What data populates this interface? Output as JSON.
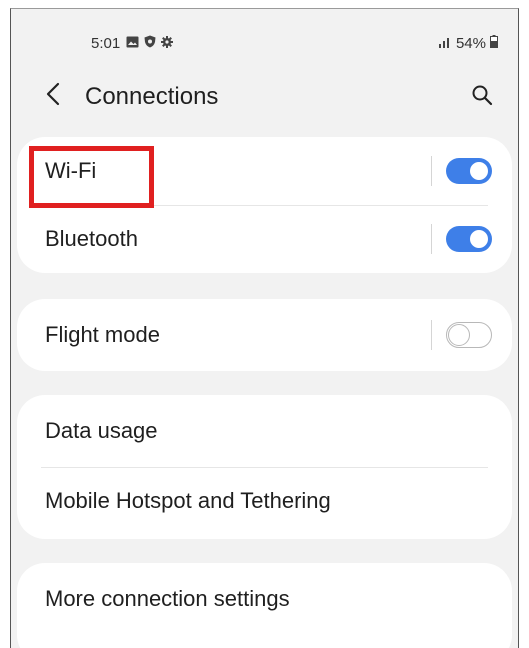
{
  "status_bar": {
    "time": "5:01",
    "icons": [
      "gallery-icon",
      "shield-icon",
      "settings-gear-icon"
    ],
    "signal_icon": "signal-icon",
    "battery_text": "54%",
    "battery_icon": "battery-icon"
  },
  "header": {
    "back_icon": "chevron-left-icon",
    "title": "Connections",
    "search_icon": "search-icon"
  },
  "groups": [
    {
      "items": [
        {
          "label": "Wi-Fi",
          "toggle": true,
          "state": "on"
        },
        {
          "label": "Bluetooth",
          "toggle": true,
          "state": "on"
        }
      ]
    },
    {
      "items": [
        {
          "label": "Flight mode",
          "toggle": true,
          "state": "off"
        }
      ]
    },
    {
      "items": [
        {
          "label": "Data usage",
          "toggle": false
        },
        {
          "label": "Mobile Hotspot and Tethering",
          "toggle": false
        }
      ]
    },
    {
      "items": [
        {
          "label": "More connection settings",
          "toggle": false
        }
      ]
    }
  ],
  "annotation": {
    "highlight_color": "#e02020",
    "highlighted_item": "Wi-Fi"
  },
  "colors": {
    "accent": "#3e7fe8",
    "background": "#f2f2f2",
    "card": "#ffffff",
    "text": "#1f1f1f"
  }
}
